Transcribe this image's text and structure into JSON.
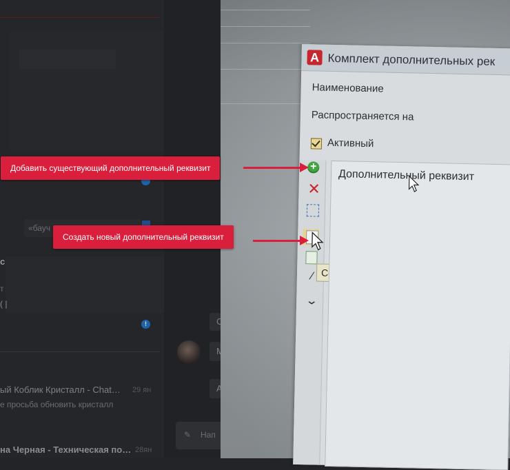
{
  "background_chat": {
    "search_hint": "«бауч",
    "letter_c": "с",
    "frag_1": "т",
    "frag_2": "( |",
    "chats": [
      {
        "title": "ый Коблик Кристалл - Chat…",
        "time": "29 ян",
        "preview": "е просьба обновить кристалл"
      },
      {
        "title": "на Черная - Техническая по…",
        "time": "28ян"
      }
    ],
    "right_letters": [
      "С",
      "М",
      "А"
    ],
    "badge_1": "!",
    "badge_2": "!",
    "search_placeholder": "Нап"
  },
  "photo_window": {
    "app_logo": "A",
    "title": "Комплект дополнительных рек",
    "name_label": "Наименование",
    "applies_label": "Распространяется на",
    "active_label": "Активный",
    "active_checked": true,
    "list_items": [
      "Дополнительный реквизит"
    ],
    "tooltip": "Создать",
    "toolbar_icons": [
      "add-icon",
      "delete-icon",
      "select-icon",
      "create-new-icon",
      "copy-icon",
      "move-up-icon",
      "move-down-icon"
    ]
  },
  "annotations": [
    {
      "label": "Добавить существующий дополнительный реквизит"
    },
    {
      "label": "Создать новый дополнительный реквизит"
    }
  ],
  "colors": {
    "callout": "#d91f3c",
    "add_icon": "#3ea53f",
    "delete_icon": "#c8262d",
    "checkbox_fill": "#e9d69a"
  }
}
